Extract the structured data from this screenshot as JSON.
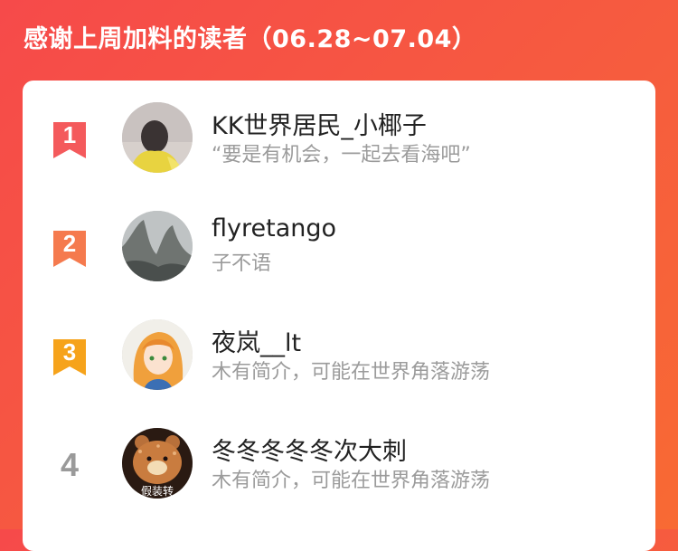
{
  "header": {
    "title": "感谢上周加料的读者（06.28~07.04）"
  },
  "colors": {
    "background": "#f64a4a",
    "rank1": "#f45a5c",
    "rank2": "#f57a4e",
    "rank3": "#f6a31b",
    "rank_other": "#9a9a9a"
  },
  "readers": [
    {
      "rank": "1",
      "name": "KK世界居民_小椰子",
      "bio": "“要是有机会，一起去看海吧”"
    },
    {
      "rank": "2",
      "name": "flyretango",
      "bio": "子不语"
    },
    {
      "rank": "3",
      "name": "夜岚__lt",
      "bio": "木有简介，可能在世界角落游荡"
    },
    {
      "rank": "4",
      "name": "冬冬冬冬冬次大刺",
      "bio": "木有简介，可能在世界角落游荡",
      "avatar_text": "假装转"
    }
  ]
}
